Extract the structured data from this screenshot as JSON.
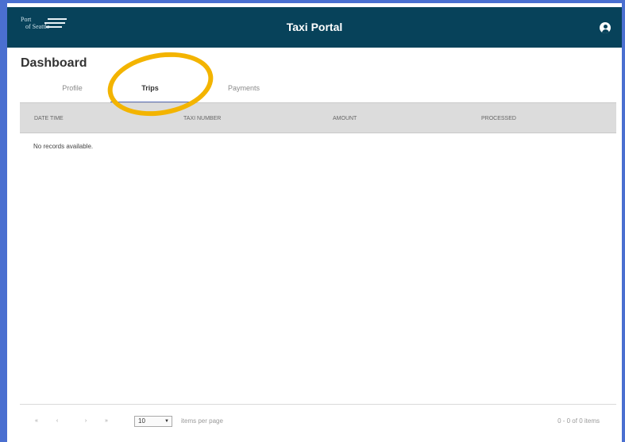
{
  "header": {
    "logo_line1": "Port",
    "logo_line2": "of Seattle",
    "title": "Taxi Portal",
    "user_icon": "user-circle-icon"
  },
  "page": {
    "title": "Dashboard"
  },
  "tabs": [
    {
      "label": "Profile",
      "active": false
    },
    {
      "label": "Trips",
      "active": true
    },
    {
      "label": "Payments",
      "active": false
    }
  ],
  "grid": {
    "columns": [
      "DATE TIME",
      "TAXI NUMBER",
      "AMOUNT",
      "PROCESSED"
    ],
    "empty_message": "No records available."
  },
  "pager": {
    "first": "«",
    "prev": "‹",
    "next": "›",
    "last": "»",
    "page_size": "10",
    "items_per_page_label": "items per page",
    "range_text": "0 - 0 of 0 items"
  },
  "colors": {
    "header_bg": "#07425a",
    "frame": "#4a6fd0",
    "highlight": "#f3b400",
    "active_tab_underline": "#5a6fb8"
  }
}
